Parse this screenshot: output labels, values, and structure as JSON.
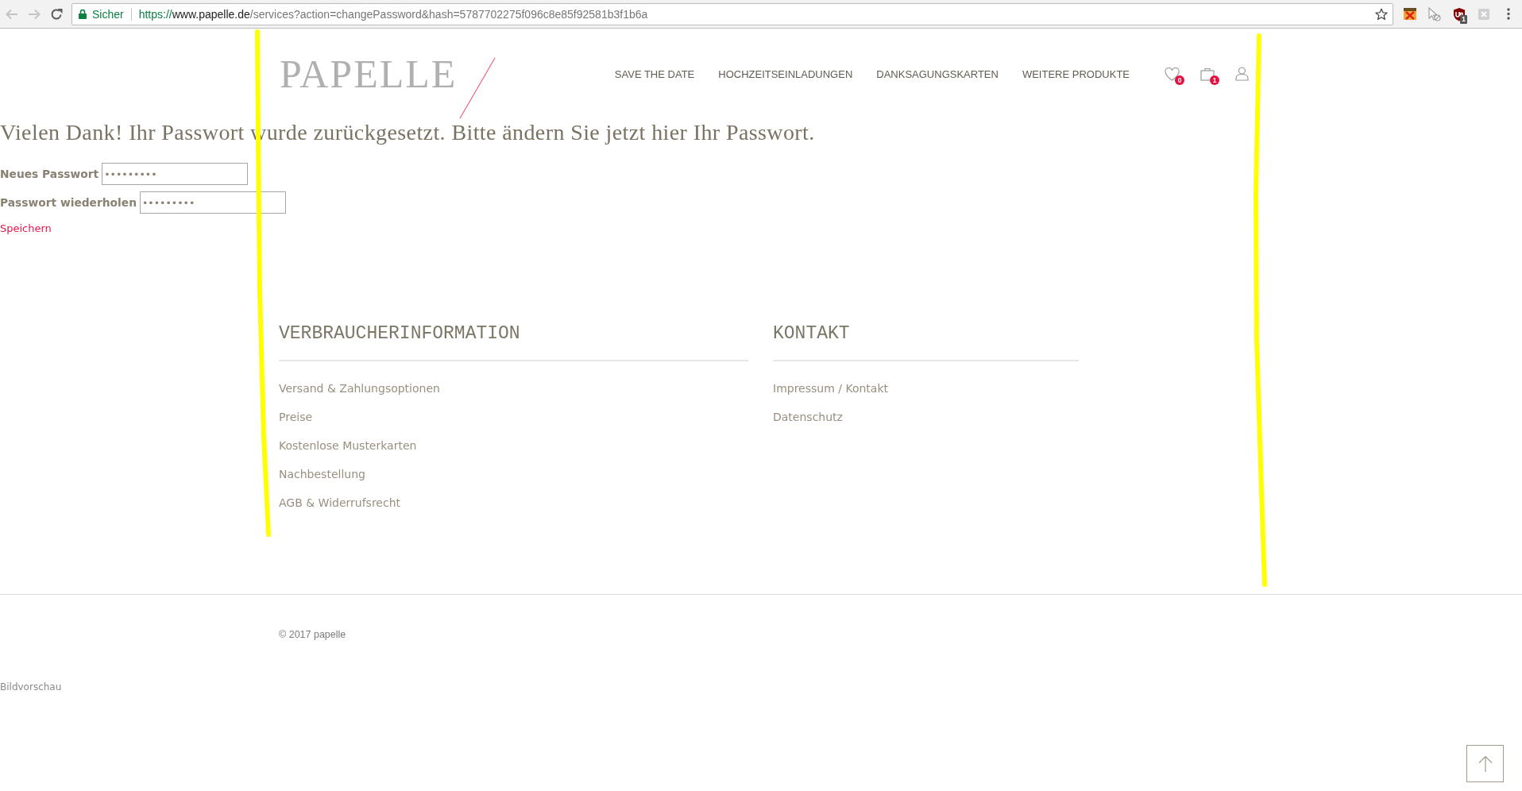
{
  "browser": {
    "nav_buttons": [
      {
        "kind": "back",
        "disabled": true
      },
      {
        "kind": "forward",
        "disabled": true
      },
      {
        "kind": "reload",
        "disabled": false
      }
    ],
    "security": "Sicher",
    "url": {
      "scheme": "https://",
      "host": "www.papelle.de",
      "path": "/services?action=changePassword&hash=5787702275f096c8e85f92581b3f1b6a"
    },
    "extensions": [
      {
        "kind": "toolbox"
      },
      {
        "kind": "cursor"
      },
      {
        "kind": "shield",
        "badge": "1"
      },
      {
        "kind": "puzzle"
      }
    ]
  },
  "header": {
    "logo": "PAPELLE",
    "nav": [
      "SAVE THE DATE",
      "HOCHZEITSEINLADUNGEN",
      "DANKSAGUNGSKARTEN",
      "WEITERE PRODUKTE"
    ],
    "icons": [
      {
        "kind": "wishlist",
        "count": "0"
      },
      {
        "kind": "cart",
        "count": "1"
      },
      {
        "kind": "account"
      }
    ]
  },
  "message": "Vielen Dank! Ihr Passwort wurde zurückgesetzt. Bitte ändern Sie jetzt hier Ihr Passwort.",
  "form": {
    "fields": [
      {
        "label": "Neues Passwort",
        "value": "•••••••••"
      },
      {
        "label": "Passwort wiederholen",
        "value": "•••••••••"
      }
    ],
    "submit": "Speichern"
  },
  "footer": {
    "columns": [
      {
        "title": "VERBRAUCHERINFORMATION",
        "links": [
          "Versand & Zahlungsoptionen",
          "Preise",
          "Kostenlose Musterkarten",
          "Nachbestellung",
          "AGB & Widerrufsrecht"
        ]
      },
      {
        "title": "KONTAKT",
        "links": [
          "Impressum / Kontakt",
          "Datenschutz"
        ]
      }
    ],
    "copyright": "© 2017 papelle"
  },
  "preview_label": "Bildvorschau"
}
